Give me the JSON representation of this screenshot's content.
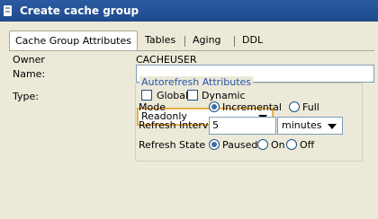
{
  "window": {
    "title": "Create cache group"
  },
  "tabs": [
    {
      "label": "Cache Group Attributes"
    },
    {
      "label": "Tables"
    },
    {
      "label": "Aging"
    },
    {
      "label": "DDL"
    }
  ],
  "form": {
    "owner_label": "Owner",
    "owner_value": "CACHEUSER",
    "name_label": "Name:",
    "name_value": "",
    "type_label": "Type:",
    "global_label": "Global",
    "dynamic_label": "Dynamic",
    "cache_type": "Readonly"
  },
  "autorefresh": {
    "title": "Autorefresh Attributes",
    "mode_label": "Mode",
    "mode_incremental": "Incremental",
    "mode_full": "Full",
    "interval_label": "Refresh Interval",
    "interval_value": "5",
    "interval_unit": "minutes",
    "state_label": "Refresh State",
    "state_paused": "Paused",
    "state_on": "On",
    "state_off": "Off"
  },
  "colors": {
    "titlebar": "#1e4b8d",
    "group_title": "#2255aa",
    "focus": "#e0a030"
  }
}
